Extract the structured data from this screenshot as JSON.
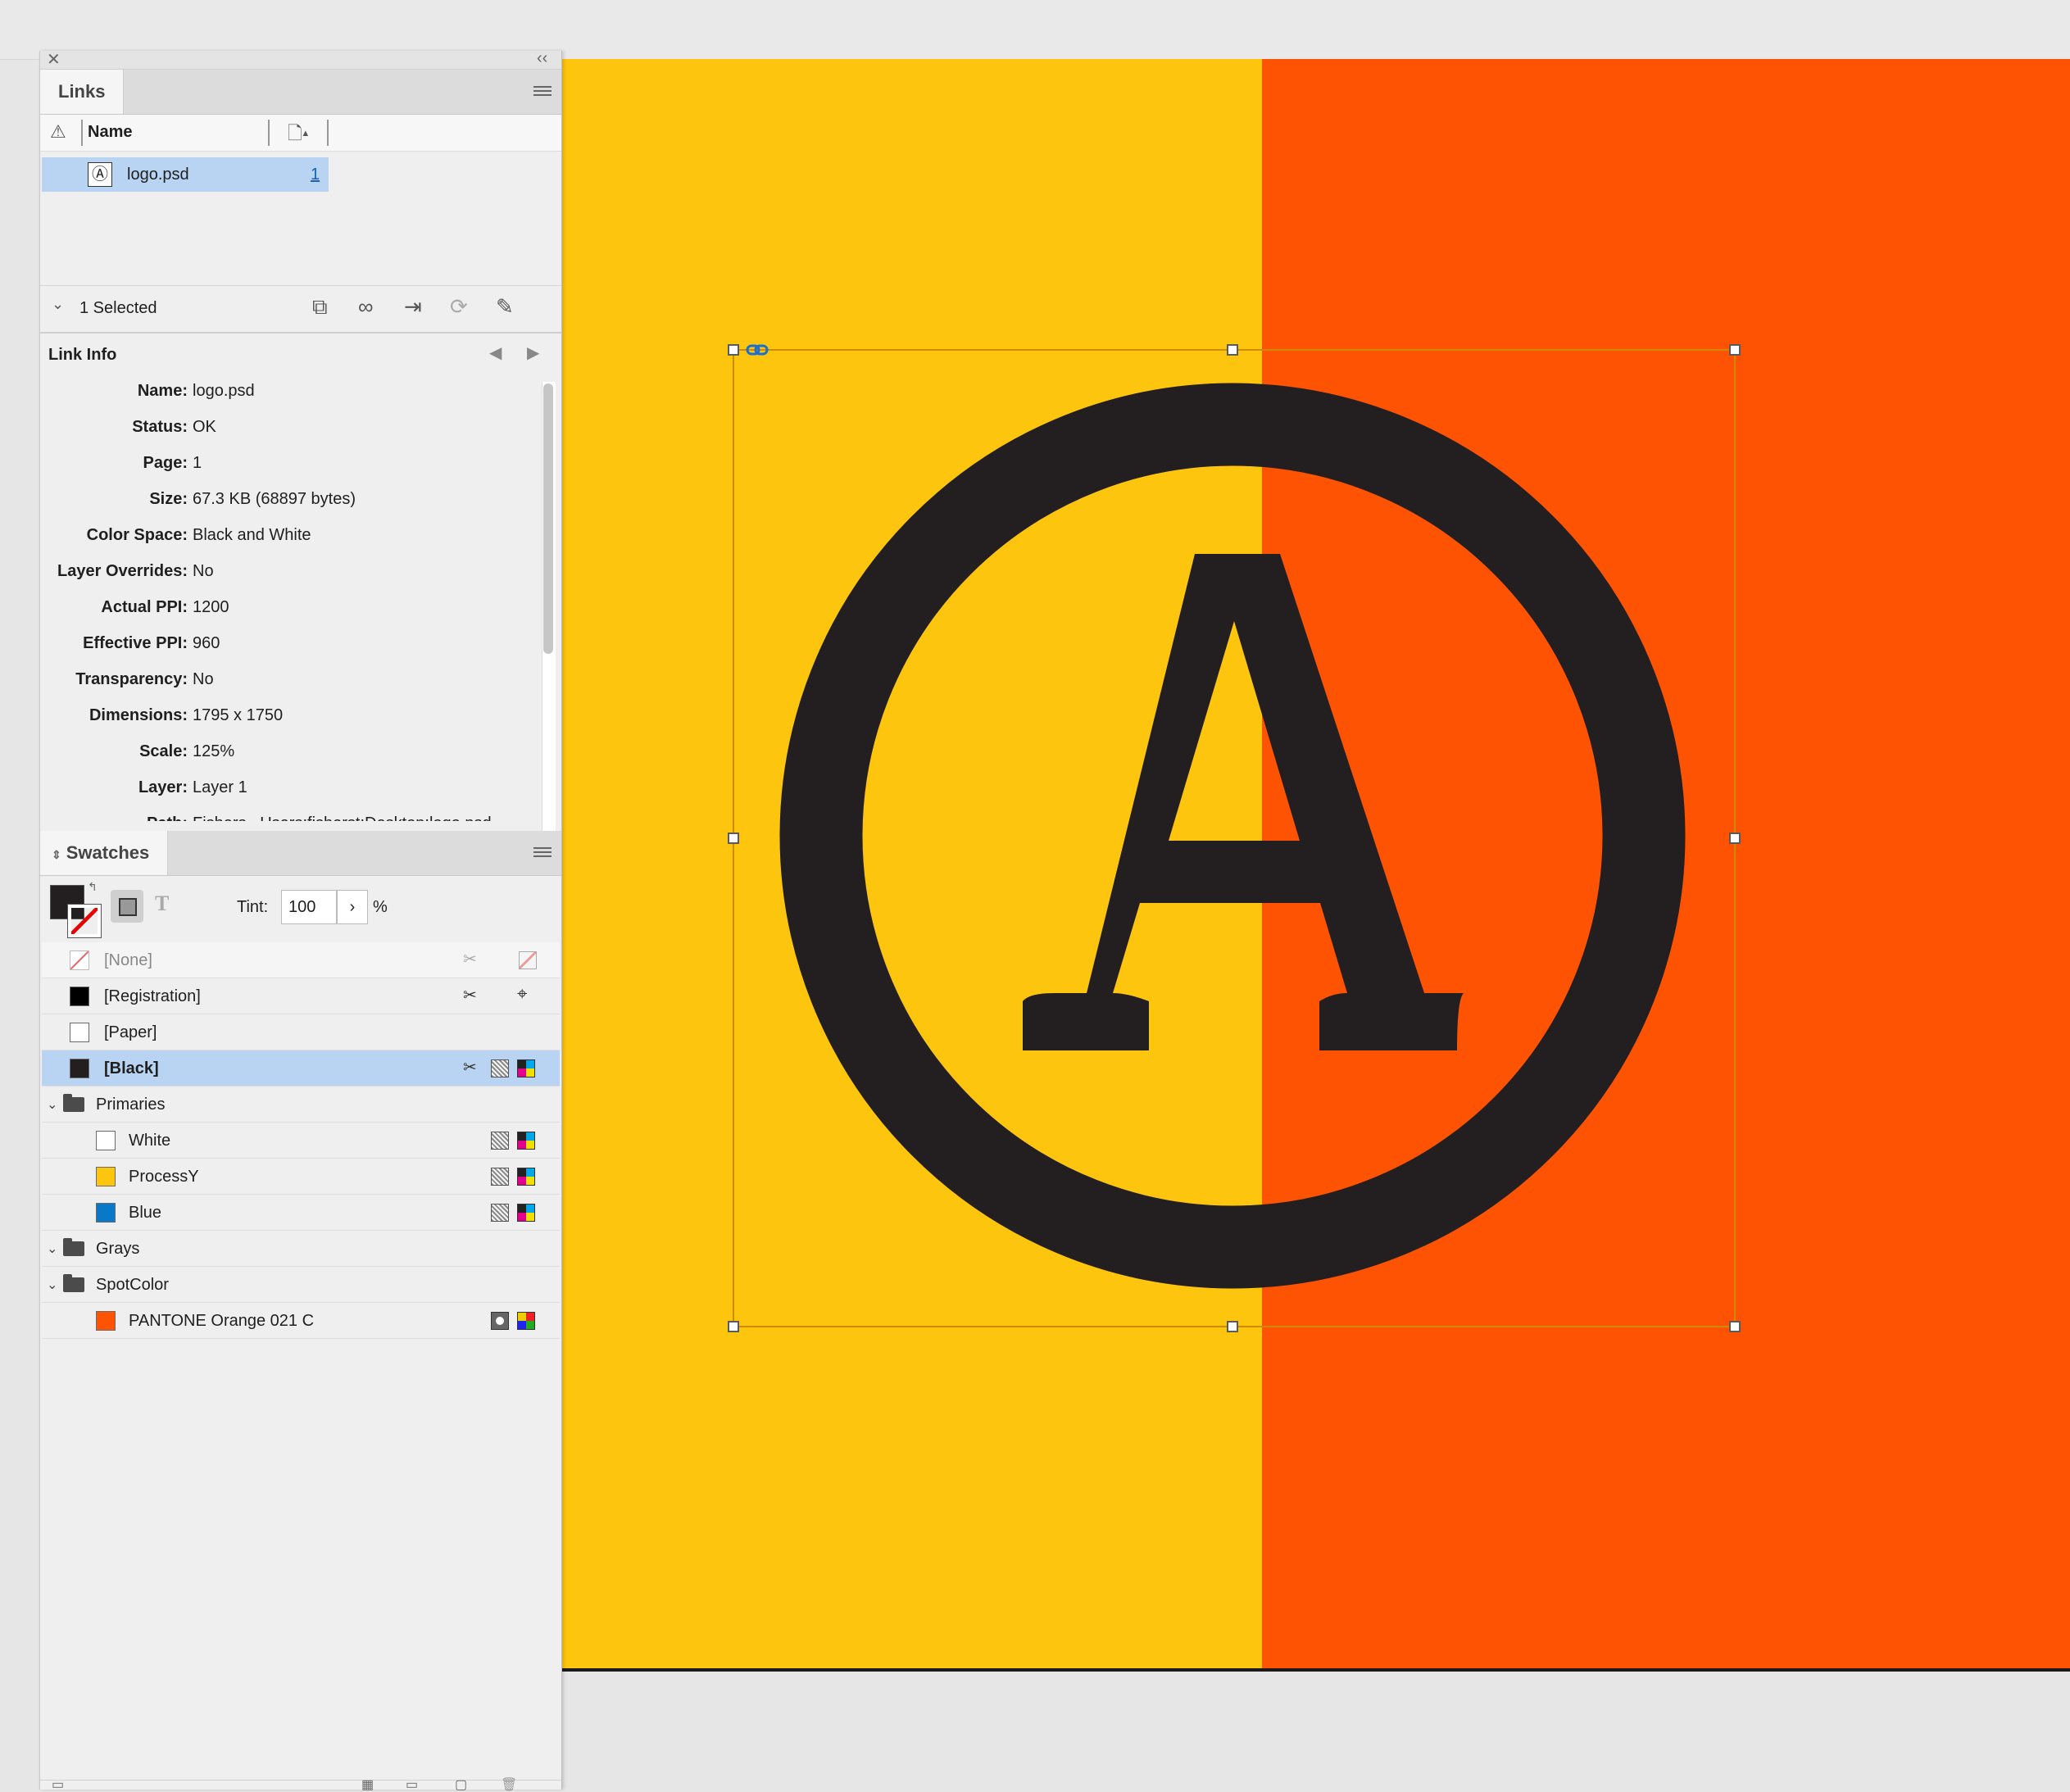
{
  "links_panel": {
    "tab_label": "Links",
    "column_name": "Name",
    "items": [
      {
        "name": "logo.psd",
        "page": "1"
      }
    ],
    "selected_label": "1 Selected"
  },
  "link_info": {
    "title": "Link Info",
    "rows": [
      {
        "label": "Name:",
        "value": "logo.psd"
      },
      {
        "label": "Status:",
        "value": "OK"
      },
      {
        "label": "Page:",
        "value": "1"
      },
      {
        "label": "Size:",
        "value": "67.3 KB (68897 bytes)"
      },
      {
        "label": "Color Space:",
        "value": "Black and White"
      },
      {
        "label": "Layer Overrides:",
        "value": "No"
      },
      {
        "label": "Actual PPI:",
        "value": "1200"
      },
      {
        "label": "Effective PPI:",
        "value": "960"
      },
      {
        "label": "Transparency:",
        "value": "No"
      },
      {
        "label": "Dimensions:",
        "value": "1795 x 1750"
      },
      {
        "label": "Scale:",
        "value": "125%"
      },
      {
        "label": "Layer:",
        "value": "Layer 1"
      },
      {
        "label": "Path:",
        "value": "Fishers...Users:fisherst:Desktop:logo.psd"
      }
    ]
  },
  "swatches_panel": {
    "tab_label": "Swatches",
    "tint_label": "Tint:",
    "tint_value": "100",
    "tint_unit": "%",
    "swatches": [
      {
        "name": "[None]",
        "color": "none"
      },
      {
        "name": "[Registration]",
        "color": "#000000"
      },
      {
        "name": "[Paper]",
        "color": "#ffffff"
      },
      {
        "name": "[Black]",
        "color": "#231f20"
      }
    ],
    "groups": [
      {
        "name": "Primaries",
        "items": [
          {
            "name": "White",
            "color": "#ffffff"
          },
          {
            "name": "ProcessY",
            "color": "#fdc50e"
          },
          {
            "name": "Blue",
            "color": "#0a78c8"
          }
        ]
      },
      {
        "name": "Grays",
        "items": []
      },
      {
        "name": "SpotColor",
        "items": [
          {
            "name": "PANTONE Orange 021 C",
            "color": "#fe5302"
          }
        ]
      }
    ]
  },
  "colors": {
    "page_yellow": "#fdc50e",
    "page_orange": "#fe5302",
    "logo_dark": "#231f20",
    "selection": "#b8d4f2",
    "frame": "#d08a00"
  }
}
